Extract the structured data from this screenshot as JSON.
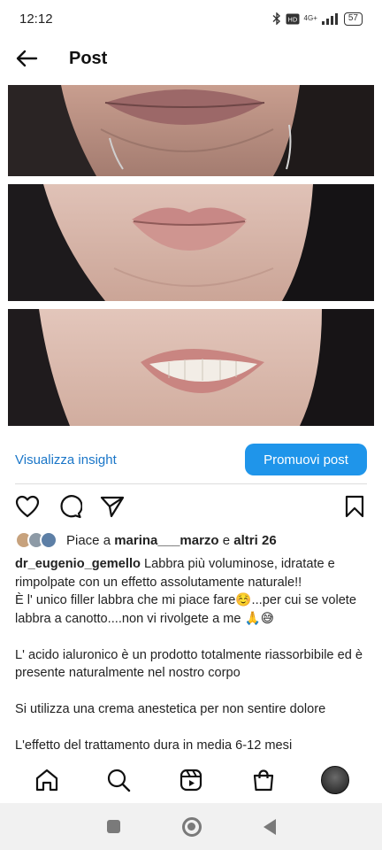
{
  "status_bar": {
    "time": "12:12",
    "network": "4G+",
    "battery": "57",
    "icons": [
      "bluetooth-icon",
      "volte-icon",
      "signal-icon",
      "battery-icon"
    ]
  },
  "header": {
    "title": "Post",
    "back_icon": "arrow-left-icon"
  },
  "post": {
    "photos": [
      {
        "name": "photo-before-lips"
      },
      {
        "name": "photo-after-lips-closed"
      },
      {
        "name": "photo-after-lips-smile"
      }
    ],
    "insight_label": "Visualizza insight",
    "promote_label": "Promuovi post",
    "actions": [
      "heart-icon",
      "comment-icon",
      "share-icon",
      "bookmark-icon"
    ],
    "likes": {
      "prefix": "Piace a ",
      "user": "marina___marzo",
      "middle": " e ",
      "others": "altri 26"
    },
    "caption": {
      "username": "dr_eugenio_gemello",
      "lines": [
        "Labbra più voluminose, idratate e rimpolpate con un effetto assolutamente naturale!!",
        "È l' unico filler labbra che mi piace fare☺️...per cui se volete labbra a canotto....non vi rivolgete a me 🙏😅",
        "",
        "L' acido ialuronico è un prodotto totalmente riassorbibile ed è presente naturalmente nel nostro corpo",
        "",
        "Si utilizza una crema anestetica per non sentire dolore",
        "",
        "L'effetto del trattamento dura in media 6-12 mesi"
      ]
    }
  },
  "bottom_nav": [
    "home-icon",
    "search-icon",
    "reels-icon",
    "shop-icon",
    "profile-avatar"
  ],
  "colors": {
    "accent": "#1f95ea",
    "link": "#1a76c8",
    "text": "#222222"
  }
}
